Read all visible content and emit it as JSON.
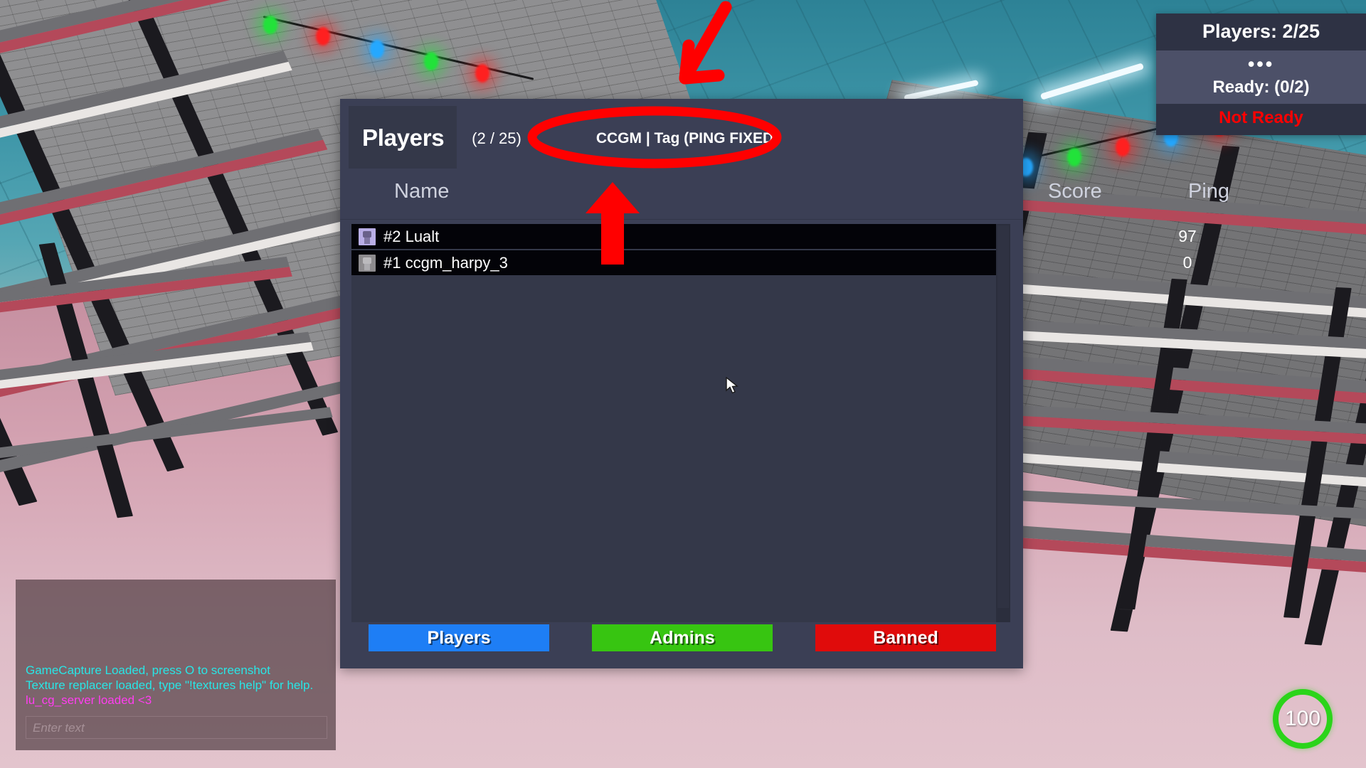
{
  "scoreboard": {
    "title": "Players",
    "count": "(2 / 25)",
    "tag": "CCGM | Tag (PING FIXED)",
    "columns": {
      "name": "Name",
      "score": "Score",
      "ping": "Ping"
    },
    "rows": [
      {
        "name": "#2 Lualt",
        "score": "",
        "ping": "97",
        "avatar": "avatar-purple",
        "menu": "kebab-menu-icon"
      },
      {
        "name": "#1 ccgm_harpy_3",
        "score": "",
        "ping": "0",
        "avatar": "avatar-gray",
        "menu": "kebab-menu-icon"
      }
    ],
    "footer_buttons": [
      {
        "label": "Players",
        "color": "#1e7ef5"
      },
      {
        "label": "Admins",
        "color": "#37c511"
      },
      {
        "label": "Banned",
        "color": "#e00b0b"
      }
    ]
  },
  "ready_hud": {
    "players": "Players: 2/25",
    "dots": "•••",
    "ready": "Ready: (0/2)",
    "status": "Not Ready",
    "status_color": "#ff0000"
  },
  "chat": {
    "lines": [
      {
        "text": "GameCapture Loaded, press O to screenshot",
        "color": "#28e6e6"
      },
      {
        "text": "Texture replacer loaded, type \"!textures help\" for help.",
        "color": "#28e6e6"
      },
      {
        "text": "lu_cg_server loaded <3",
        "color": "#ff3df0"
      }
    ],
    "input_placeholder": "Enter text"
  },
  "health": {
    "value": "100",
    "color": "#2bd41a"
  },
  "annotations": {
    "ellipse_color": "#ff0000",
    "arrow_color": "#ff0000",
    "ellipse_target": "CCGM | Tag (PING FIXED)",
    "arrow_up_target": "tag-label",
    "arrow_down_target": "tag-ellipse"
  }
}
